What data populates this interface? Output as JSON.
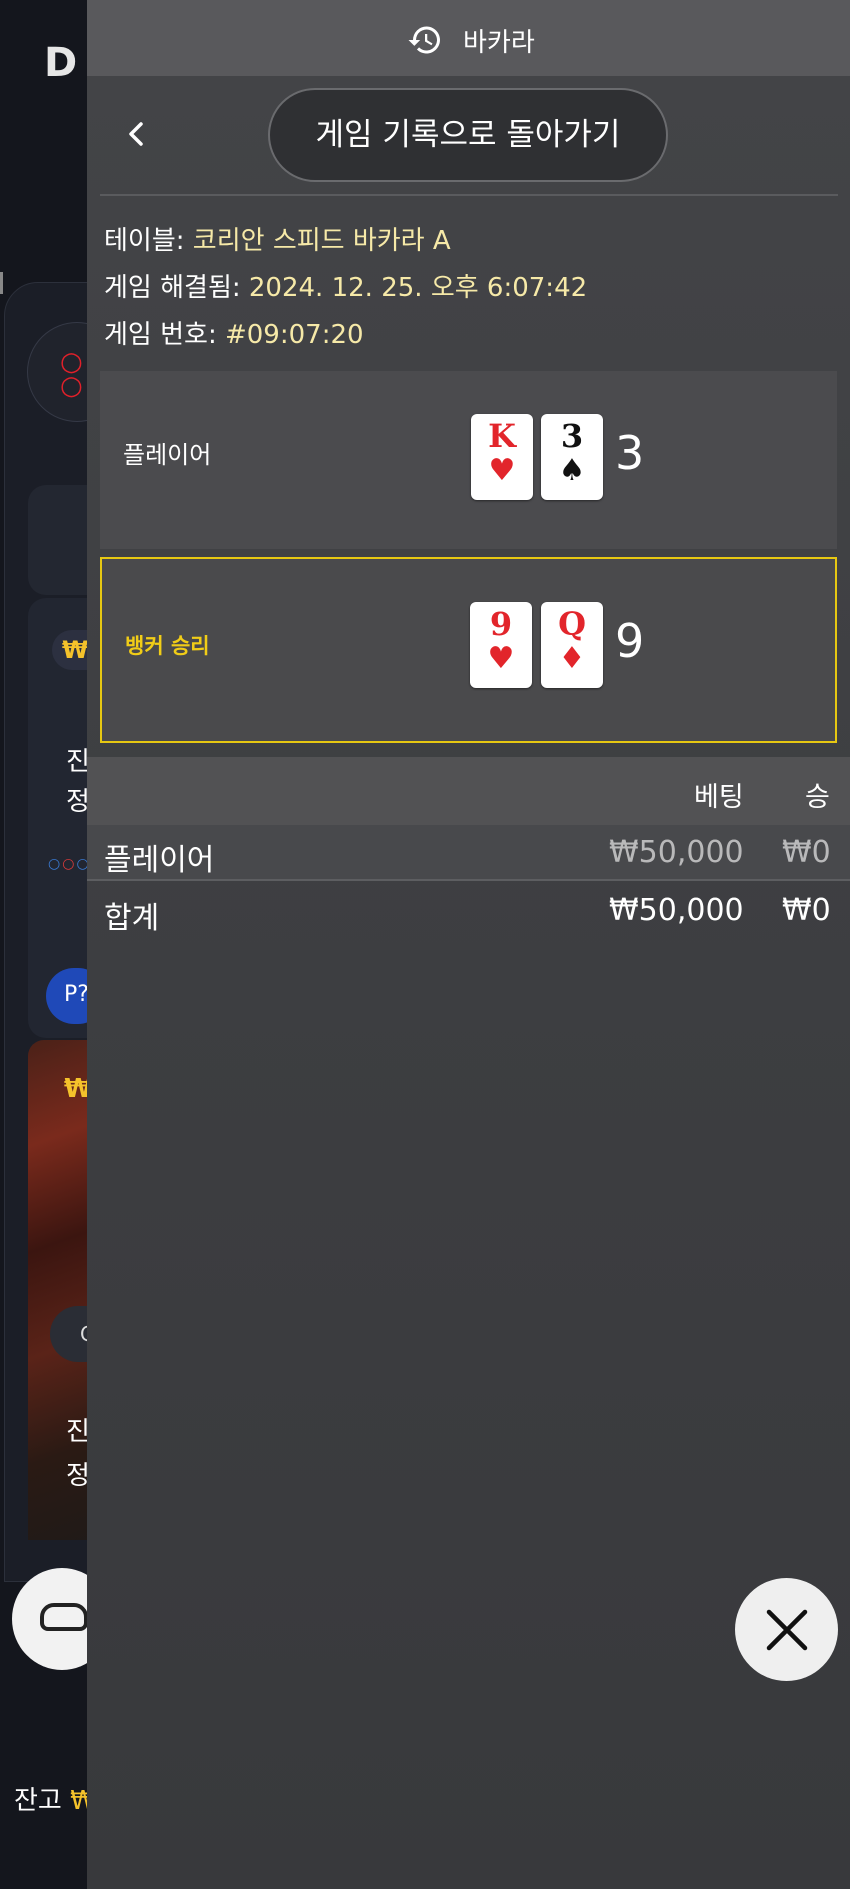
{
  "header": {
    "title": "바카라",
    "icon": "history-icon"
  },
  "nav": {
    "back_label": "게임 기록으로 돌아가기",
    "back_icon": "chevron-left-icon"
  },
  "details": {
    "table_label": "테이블:",
    "table_value": "코리안 스피드 바카라 A",
    "resolved_label": "게임 해결됨:",
    "resolved_value": "2024. 12. 25. 오후 6:07:42",
    "round_label": "게임 번호:",
    "round_value": "#09:07:20"
  },
  "hands": {
    "player": {
      "label": "플레이어",
      "cards": [
        {
          "rank": "K",
          "suit": "♥",
          "color": "#e2252b"
        },
        {
          "rank": "3",
          "suit": "♠",
          "color": "#111111"
        }
      ],
      "score": "3"
    },
    "banker": {
      "label": "뱅커 승리",
      "cards": [
        {
          "rank": "9",
          "suit": "♥",
          "color": "#e2252b"
        },
        {
          "rank": "Q",
          "suit": "♦",
          "color": "#e2252b"
        }
      ],
      "score": "9",
      "highlight_color": "#e7c812"
    }
  },
  "bets": {
    "columns": {
      "bet": "베팅",
      "win": "승"
    },
    "rows": [
      {
        "name": "플레이어",
        "bet": "₩50,000",
        "win": "₩0"
      }
    ],
    "total": {
      "name": "합계",
      "bet": "₩50,000",
      "win": "₩0"
    }
  },
  "close_icon": "close-icon",
  "background_app": {
    "won_badge": "₩",
    "text_block_1": [
      "진",
      "정"
    ],
    "p_badge": "P?",
    "photo_won": "₩",
    "photo_pill": "C",
    "text_block_2": [
      "진",
      "정"
    ],
    "balance_label": "잔고",
    "balance_currency": "₩"
  }
}
